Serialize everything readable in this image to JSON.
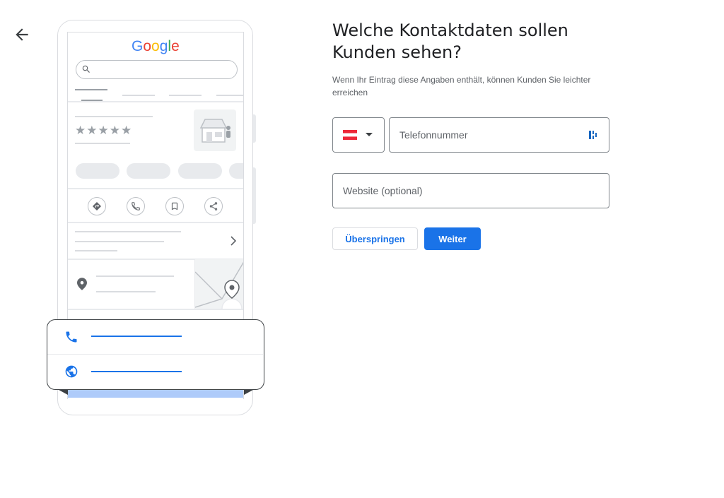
{
  "header": {
    "title": "Welche Kontaktdaten sollen Kunden sehen?",
    "subtitle": "Wenn Ihr Eintrag diese Angaben enthält, können Kunden Sie leichter erreichen"
  },
  "illustration": {
    "google_logo": "Google",
    "rating_stars": "★★★★★",
    "icons": [
      "directions-icon",
      "phone-icon",
      "bookmark-icon",
      "share-icon",
      "location-pin-icon",
      "map-pin-icon",
      "phone-icon",
      "globe-icon"
    ]
  },
  "form": {
    "country": {
      "flag": "Austria",
      "flag_colors": [
        "#ed2939",
        "#ffffff",
        "#ed2939"
      ]
    },
    "phone": {
      "placeholder": "Telefonnummer",
      "value": ""
    },
    "website": {
      "placeholder": "Website (optional)",
      "value": ""
    }
  },
  "buttons": {
    "skip_label": "Überspringen",
    "next_label": "Weiter"
  },
  "colors": {
    "accent": "#1a73e8",
    "text_primary": "#202124",
    "text_secondary": "#5f6368",
    "outline": "#dadce0"
  }
}
